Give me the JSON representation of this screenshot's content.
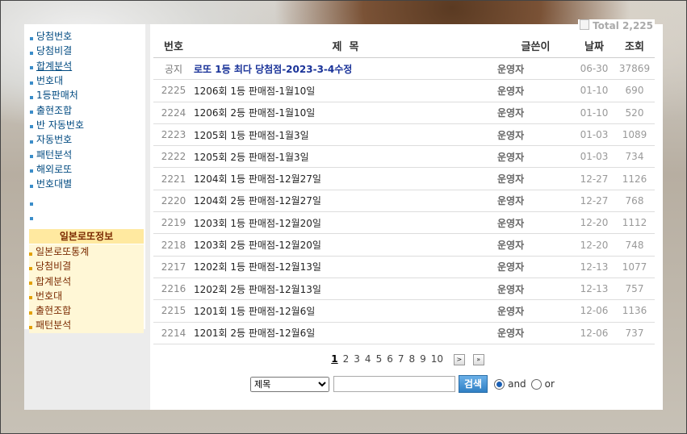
{
  "sidebar": {
    "items": [
      {
        "label": "당첨번호"
      },
      {
        "label": "당첨비결"
      },
      {
        "label": "합계분석"
      },
      {
        "label": "번호대"
      },
      {
        "label": "1등판매처"
      },
      {
        "label": "출현조합"
      },
      {
        "label": "반 자동번호"
      },
      {
        "label": "자동번호"
      },
      {
        "label": "패턴분석"
      },
      {
        "label": "해외로또"
      },
      {
        "label": "번호대별"
      }
    ],
    "section_title": "일본로또정보",
    "jp_items": [
      {
        "label": "일본로또통계"
      },
      {
        "label": "당첨비결"
      },
      {
        "label": "합계분석"
      },
      {
        "label": "번호대"
      },
      {
        "label": "출현조합"
      },
      {
        "label": "패턴분석"
      }
    ]
  },
  "board": {
    "total": "Total 2,225",
    "headers": {
      "num": "번호",
      "title": "제  목",
      "writer": "글쓴이",
      "date": "날짜",
      "views": "조회"
    },
    "rows": [
      {
        "num": "공지",
        "title": "로또 1등 최다 당첨점-2023-3-4수정",
        "writer": "운영자",
        "date": "06-30",
        "views": "37869"
      },
      {
        "num": "2225",
        "title": "1206회 1등 판매점-1월10일",
        "writer": "운영자",
        "date": "01-10",
        "views": "690"
      },
      {
        "num": "2224",
        "title": "1206회 2등 판매점-1월10일",
        "writer": "운영자",
        "date": "01-10",
        "views": "520"
      },
      {
        "num": "2223",
        "title": "1205회 1등 판매점-1월3일",
        "writer": "운영자",
        "date": "01-03",
        "views": "1089"
      },
      {
        "num": "2222",
        "title": "1205회 2등 판매점-1월3일",
        "writer": "운영자",
        "date": "01-03",
        "views": "734"
      },
      {
        "num": "2221",
        "title": "1204회 1등 판매점-12월27일",
        "writer": "운영자",
        "date": "12-27",
        "views": "1126"
      },
      {
        "num": "2220",
        "title": "1204회 2등 판매점-12월27일",
        "writer": "운영자",
        "date": "12-27",
        "views": "768"
      },
      {
        "num": "2219",
        "title": "1203회 1등 판매점-12월20일",
        "writer": "운영자",
        "date": "12-20",
        "views": "1112"
      },
      {
        "num": "2218",
        "title": "1203회 2등 판매점-12월20일",
        "writer": "운영자",
        "date": "12-20",
        "views": "748"
      },
      {
        "num": "2217",
        "title": "1202회 1등 판매점-12월13일",
        "writer": "운영자",
        "date": "12-13",
        "views": "1077"
      },
      {
        "num": "2216",
        "title": "1202회 2등 판매점-12월13일",
        "writer": "운영자",
        "date": "12-13",
        "views": "757"
      },
      {
        "num": "2215",
        "title": "1201회 1등 판매점-12월6일",
        "writer": "운영자",
        "date": "12-06",
        "views": "1136"
      },
      {
        "num": "2214",
        "title": "1201회 2등 판매점-12월6일",
        "writer": "운영자",
        "date": "12-06",
        "views": "737"
      }
    ]
  },
  "pager": {
    "pages": [
      "1",
      "2",
      "3",
      "4",
      "5",
      "6",
      "7",
      "8",
      "9",
      "10"
    ],
    "current": "1",
    "next": ">",
    "last": "»"
  },
  "search": {
    "field_selected": "제목",
    "query": "",
    "button": "검색",
    "opt_and": "and",
    "opt_or": "or",
    "selected": "and"
  }
}
